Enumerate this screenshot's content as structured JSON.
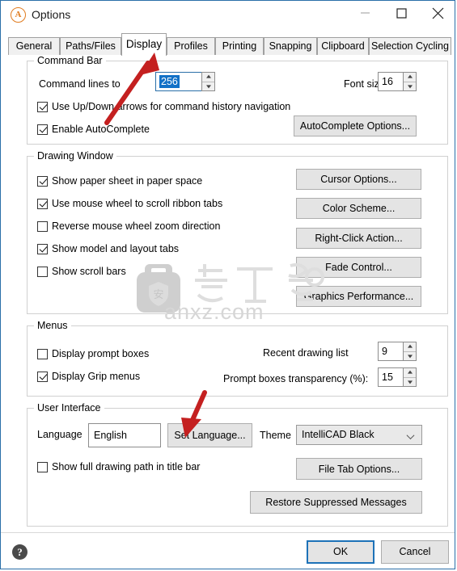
{
  "window": {
    "title": "Options",
    "logo_icon": "intellicad-logo-icon",
    "controls": {
      "minimize": "minimize-icon",
      "maximize": "maximize-icon",
      "close": "close-icon"
    }
  },
  "tabs": [
    {
      "label": "General",
      "active": false
    },
    {
      "label": "Paths/Files",
      "active": false
    },
    {
      "label": "Display",
      "active": true
    },
    {
      "label": "Profiles",
      "active": false
    },
    {
      "label": "Printing",
      "active": false
    },
    {
      "label": "Snapping",
      "active": false
    },
    {
      "label": "Clipboard",
      "active": false
    },
    {
      "label": "Selection Cycling",
      "active": false
    }
  ],
  "command_bar": {
    "title": "Command Bar",
    "command_lines_label": "Command lines to",
    "command_lines_value": "256",
    "font_size_label": "Font size:",
    "font_size_value": "16",
    "checkboxes": [
      {
        "label": "Use Up/Down arrows for command history navigation",
        "checked": true
      },
      {
        "label": "Enable AutoComplete",
        "checked": true
      }
    ],
    "autocomplete_button": "AutoComplete Options..."
  },
  "drawing_window": {
    "title": "Drawing Window",
    "checkboxes": [
      {
        "label": "Show paper sheet in paper space",
        "checked": true
      },
      {
        "label": "Use mouse wheel to scroll ribbon tabs",
        "checked": true
      },
      {
        "label": "Reverse mouse wheel zoom direction",
        "checked": false
      },
      {
        "label": "Show model and layout tabs",
        "checked": true
      },
      {
        "label": "Show scroll bars",
        "checked": false
      }
    ],
    "buttons": [
      "Cursor Options...",
      "Color Scheme...",
      "Right-Click Action...",
      "Fade Control...",
      "Graphics Performance..."
    ]
  },
  "menus": {
    "title": "Menus",
    "checkboxes": [
      {
        "label": "Display prompt boxes",
        "checked": false
      },
      {
        "label": "Display Grip menus",
        "checked": true
      }
    ],
    "recent_drawing_label": "Recent drawing list",
    "recent_drawing_value": "9",
    "transparency_label": "Prompt boxes transparency (%):",
    "transparency_value": "15"
  },
  "user_interface": {
    "title": "User Interface",
    "language_label": "Language",
    "language_value": "English",
    "set_language_button": "Set Language...",
    "theme_label": "Theme",
    "theme_value": "IntelliCAD Black",
    "show_full_path": {
      "label": "Show full drawing path in title bar",
      "checked": false
    },
    "file_tab_button": "File Tab Options...",
    "restore_messages_button": "Restore Suppressed Messages"
  },
  "footer": {
    "help_icon": "help-icon",
    "ok_label": "OK",
    "cancel_label": "Cancel"
  },
  "watermark": {
    "text": "anxz.com"
  },
  "colors": {
    "dialog_border": "#2a6fa8",
    "accent": "#1d72b8",
    "selection": "#1271c7",
    "annotation_arrow": "#c42020",
    "logo": "#e07b1e"
  }
}
